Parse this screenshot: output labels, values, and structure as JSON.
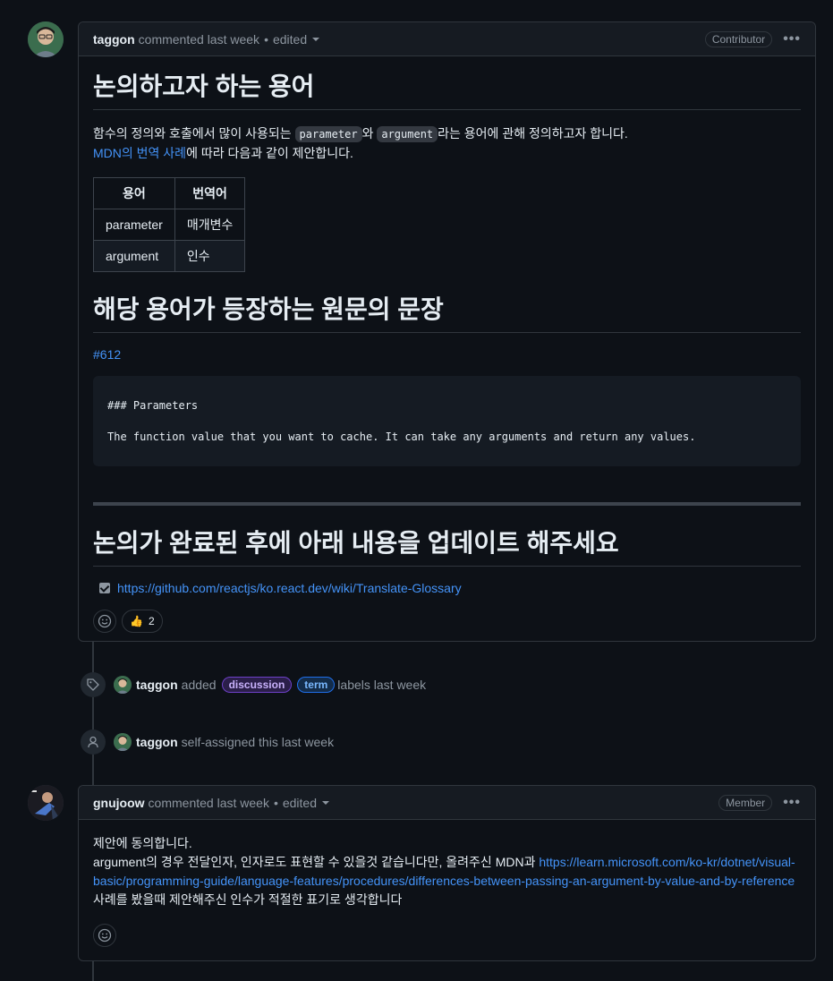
{
  "comment1": {
    "author": "taggon",
    "meta": "commented last week",
    "edited": "edited",
    "role": "Contributor",
    "heading1": "논의하고자 하는 용어",
    "intro_pre": "함수의 정의와 호출에서 많이 사용되는",
    "code1": "parameter",
    "intro_mid": "와",
    "code2": "argument",
    "intro_post": "라는 용어에 관해 정의하고자 합니다.",
    "mdn_link": "MDN의 번역 사례",
    "mdn_post": "에 따라 다음과 같이 제안합니다.",
    "table": {
      "headers": [
        "용어",
        "번역어"
      ],
      "rows": [
        [
          "parameter",
          "매개변수"
        ],
        [
          "argument",
          "인수"
        ]
      ]
    },
    "heading2": "해당 용어가 등장하는 원문의 문장",
    "issue_link": "#612",
    "code_line1": "### Parameters",
    "code_line2": "The function value that you want to cache. It can take any arguments and return any values.",
    "heading3": "논의가 완료된 후에 아래 내용을 업데이트 해주세요",
    "task_link": "https://github.com/reactjs/ko.react.dev/wiki/Translate-Glossary",
    "thumbs_count": "2"
  },
  "events": [
    {
      "author": "taggon",
      "pre": "added",
      "labels": [
        {
          "name": "discussion",
          "color": "#a371f7"
        },
        {
          "name": "term",
          "color": "#4493f8"
        }
      ],
      "post": "labels last week"
    },
    {
      "author": "taggon",
      "text": "self-assigned this last week"
    }
  ],
  "comment2": {
    "author": "gnujoow",
    "meta": "commented last week",
    "edited": "edited",
    "role": "Member",
    "line1": "제안에 동의합니다.",
    "line2_pre": "argument의 경우 전달인자, 인자로도 표현할 수 있을것 같습니다만, 올려주신 MDN과",
    "link": "https://learn.microsoft.com/ko-kr/dotnet/visual-basic/programming-guide/language-features/procedures/differences-between-passing-an-argument-by-value-and-by-reference",
    "line2_post": "사례를 봤을때 제안해주신 인수가 적절한 표기로 생각합니다"
  },
  "icons": {
    "kebab": "kebab-horizontal-icon",
    "smiley": "smiley-icon",
    "tag": "tag-icon",
    "person": "person-icon",
    "thumbs": "👍",
    "dots": "•••",
    "separator": "•"
  }
}
